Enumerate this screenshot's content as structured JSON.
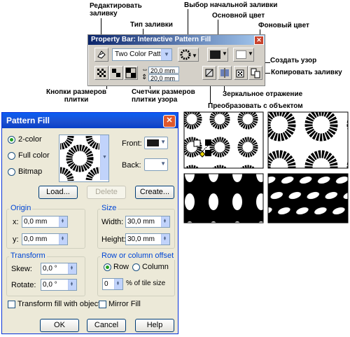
{
  "annotations": {
    "edit_fill": "Редактировать\nзаливку",
    "fill_type": "Тип заливки",
    "pick_start": "Выбор начальной заливки",
    "main_color": "Основной цвет",
    "bg_color": "Фоновый цвет",
    "create_pattern": "Создать узор",
    "copy_fill": "Копировать заливку",
    "tile_size_buttons": "Кнопки размеров\nплитки",
    "tile_size_counter": "Счетчик размеров\nплитки узора",
    "mirror": "Зеркальное отражение",
    "transform_with_object": "Преобразовать с объектом"
  },
  "property_bar": {
    "title": "Property Bar: Interactive Pattern Fill",
    "fill_type_value": "Two Color Patt...",
    "width_value": "20,0 mm",
    "height_value": "20,0 mm",
    "colors": {
      "front": "#1a1a1a",
      "back": "#ffffff"
    }
  },
  "dialog": {
    "title": "Pattern Fill",
    "radios": {
      "two_color": "2-color",
      "full_color": "Full color",
      "bitmap": "Bitmap"
    },
    "front_label": "Front:",
    "back_label": "Back:",
    "buttons": {
      "load": "Load...",
      "delete": "Delete",
      "create": "Create...",
      "ok": "OK",
      "cancel": "Cancel",
      "help": "Help"
    },
    "origin": {
      "title": "Origin",
      "x_label": "x:",
      "x_value": "0,0 mm",
      "y_label": "y:",
      "y_value": "0,0 mm"
    },
    "size": {
      "title": "Size",
      "width_label": "Width:",
      "width_value": "30,0 mm",
      "height_label": "Height:",
      "height_value": "30,0 mm"
    },
    "transform": {
      "title": "Transform",
      "skew_label": "Skew:",
      "skew_value": "0,0 °",
      "rotate_label": "Rotate:",
      "rotate_value": "0,0 °"
    },
    "offset": {
      "title": "Row or column offset",
      "row": "Row",
      "column": "Column",
      "value": "0",
      "unit": "% of tile size"
    },
    "transform_fill": "Transform fill with object",
    "mirror_fill": "Mirror Fill"
  }
}
